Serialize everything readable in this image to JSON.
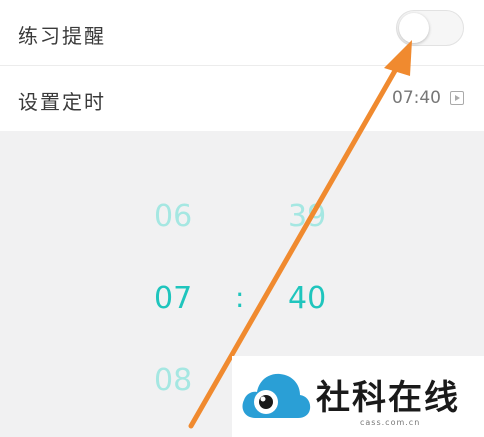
{
  "settings": {
    "practice_reminder_label": "练习提醒",
    "practice_reminder_on": false,
    "set_timer_label": "设置定时",
    "set_timer_value": "07:40"
  },
  "picker": {
    "hours": [
      "06",
      "07",
      "08"
    ],
    "minutes": [
      "39",
      "40"
    ],
    "separator": ":",
    "selected_hour": "07",
    "selected_minute": "40"
  },
  "watermark": {
    "brand": "社科在线",
    "domain": "cass.com.cn"
  },
  "colors": {
    "accent": "#1fc5bd",
    "accent_faded": "#a5e7e2",
    "annotation_arrow": "#f08a2f"
  }
}
